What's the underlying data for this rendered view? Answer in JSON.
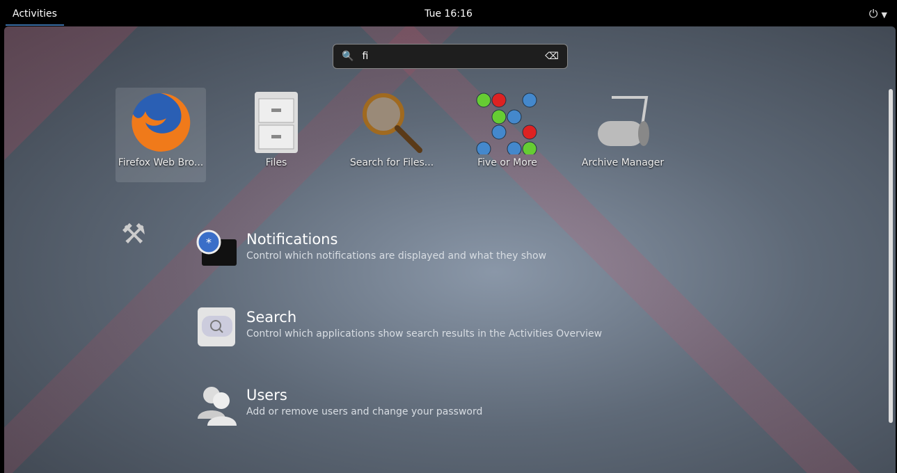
{
  "topbar": {
    "activities": "Activities",
    "clock": "Tue 16:16",
    "power_icon": "power-icon",
    "menu_icon": "chevron-down-icon"
  },
  "search": {
    "value": "fi",
    "search_icon": "search-icon",
    "clear_icon": "clear-icon"
  },
  "apps": [
    {
      "label": "Firefox Web Bro...",
      "icon": "firefox-icon",
      "selected": true
    },
    {
      "label": "Files",
      "icon": "file-cabinet-icon"
    },
    {
      "label": "Search for Files...",
      "icon": "magnifier-icon"
    },
    {
      "label": "Five or More",
      "icon": "balls-icon"
    },
    {
      "label": "Archive Manager",
      "icon": "archive-roller-icon"
    }
  ],
  "settings_provider_icon": "tools-icon",
  "settings": [
    {
      "title": "Notifications",
      "desc": "Control which notifications are displayed and what they show",
      "icon": "notifications-icon"
    },
    {
      "title": "Search",
      "desc": "Control which applications show search results in the Activities Overview",
      "icon": "search-settings-icon"
    },
    {
      "title": "Users",
      "desc": "Add or remove users and change your password",
      "icon": "users-icon"
    }
  ]
}
